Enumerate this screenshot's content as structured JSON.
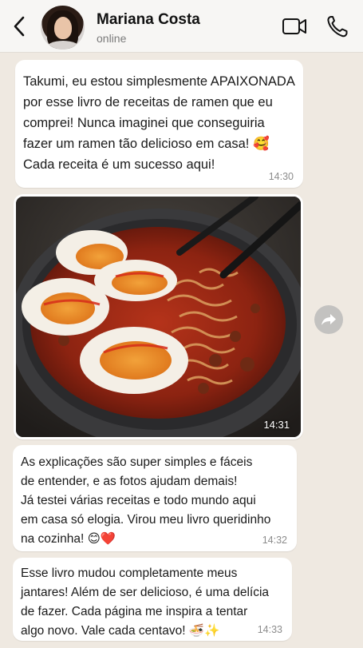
{
  "header": {
    "contact_name": "Mariana Costa",
    "status": "online",
    "icons": {
      "back": "chevron-left-icon",
      "video": "video-call-icon",
      "call": "phone-icon"
    }
  },
  "messages": [
    {
      "type": "text",
      "text": "Takumi, eu estou simplesmente APAIXONADA\npor esse livro de receitas de ramen que eu\ncomprei! Nunca imaginei que conseguiria\nfazer um ramen tão delicioso em casa! 🥰\nCada receita é um sucesso aqui!",
      "time": "14:30"
    },
    {
      "type": "image",
      "description_icon": "ramen-photo",
      "time": "14:31"
    },
    {
      "type": "text",
      "text": "As explicações são super simples e fáceis\nde entender, e as fotos ajudam demais!\nJá testei várias receitas e todo mundo aqui\nem casa só elogia. Virou meu livro queridinho\nna cozinha! 😊❤️",
      "time": "14:32"
    },
    {
      "type": "text",
      "text": "Esse livro mudou completamente meus\njantares! Além de ser delicioso, é uma delícia\nde fazer. Cada página me inspira a tentar\nalgo novo. Vale cada centavo! 🍜✨",
      "time": "14:33"
    }
  ],
  "colors": {
    "chat_background": "#efe9e1",
    "bubble": "#ffffff",
    "time_text": "#8c8c8c"
  }
}
